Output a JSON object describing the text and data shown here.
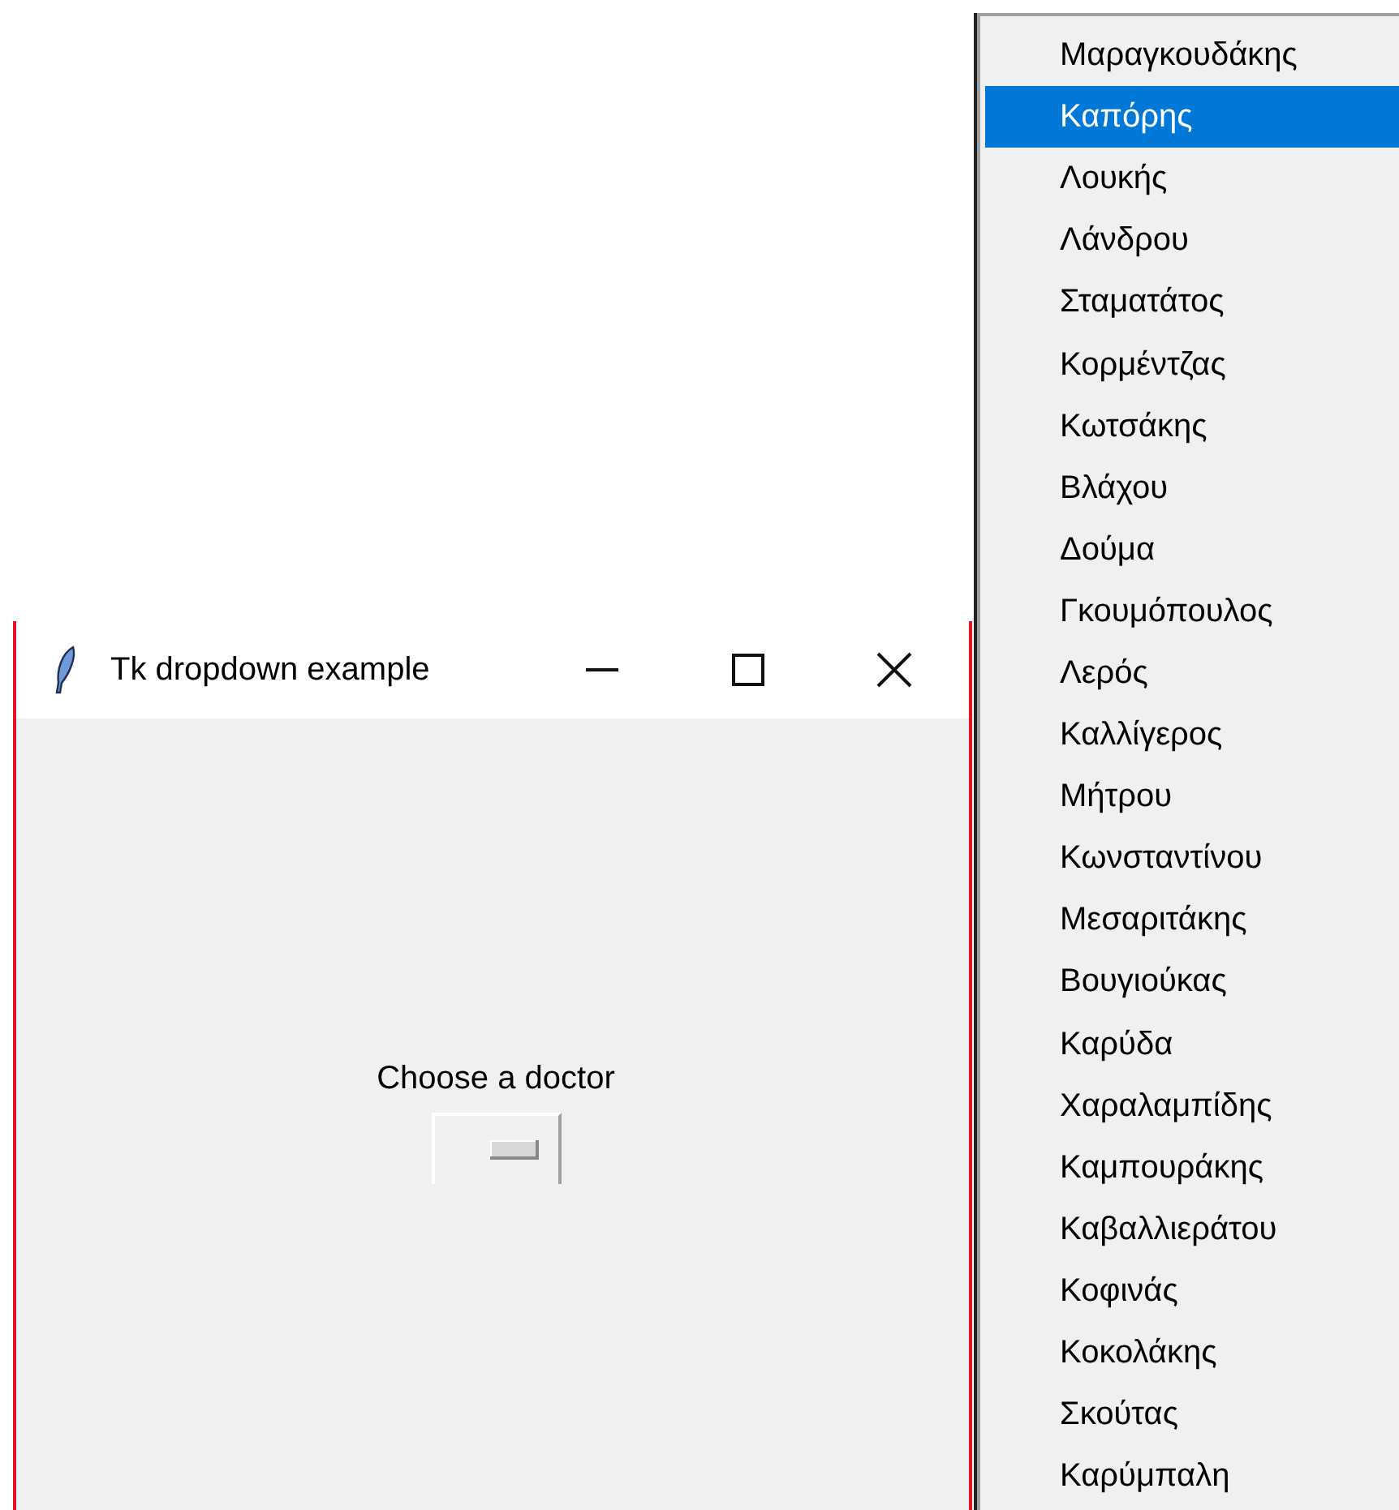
{
  "window": {
    "title": "Tk dropdown example"
  },
  "label": "Choose a doctor",
  "menu": {
    "items": [
      {
        "label": "Μαραγκουδάκης",
        "selected": false
      },
      {
        "label": "Καπόρης",
        "selected": true
      },
      {
        "label": "Λουκής",
        "selected": false
      },
      {
        "label": "Λάνδρου",
        "selected": false
      },
      {
        "label": "Σταματάτος",
        "selected": false
      },
      {
        "label": "Κορμέντζας",
        "selected": false
      },
      {
        "label": "Κωτσάκης",
        "selected": false
      },
      {
        "label": "Βλάχου",
        "selected": false
      },
      {
        "label": "Δούμα",
        "selected": false
      },
      {
        "label": "Γκουμόπουλος",
        "selected": false
      },
      {
        "label": "Λερός",
        "selected": false
      },
      {
        "label": "Καλλίγερος",
        "selected": false
      },
      {
        "label": "Μήτρου",
        "selected": false
      },
      {
        "label": "Κωνσταντίνου",
        "selected": false
      },
      {
        "label": "Μεσαριτάκης",
        "selected": false
      },
      {
        "label": "Βουγιούκας",
        "selected": false
      },
      {
        "label": "Καρύδα",
        "selected": false
      },
      {
        "label": "Χαραλαμπίδης",
        "selected": false
      },
      {
        "label": "Καμπουράκης",
        "selected": false
      },
      {
        "label": "Καβαλλιεράτου",
        "selected": false
      },
      {
        "label": "Κοφινάς",
        "selected": false
      },
      {
        "label": "Κοκολάκης",
        "selected": false
      },
      {
        "label": "Σκούτας",
        "selected": false
      },
      {
        "label": "Καρύμπαλη",
        "selected": false
      }
    ]
  }
}
